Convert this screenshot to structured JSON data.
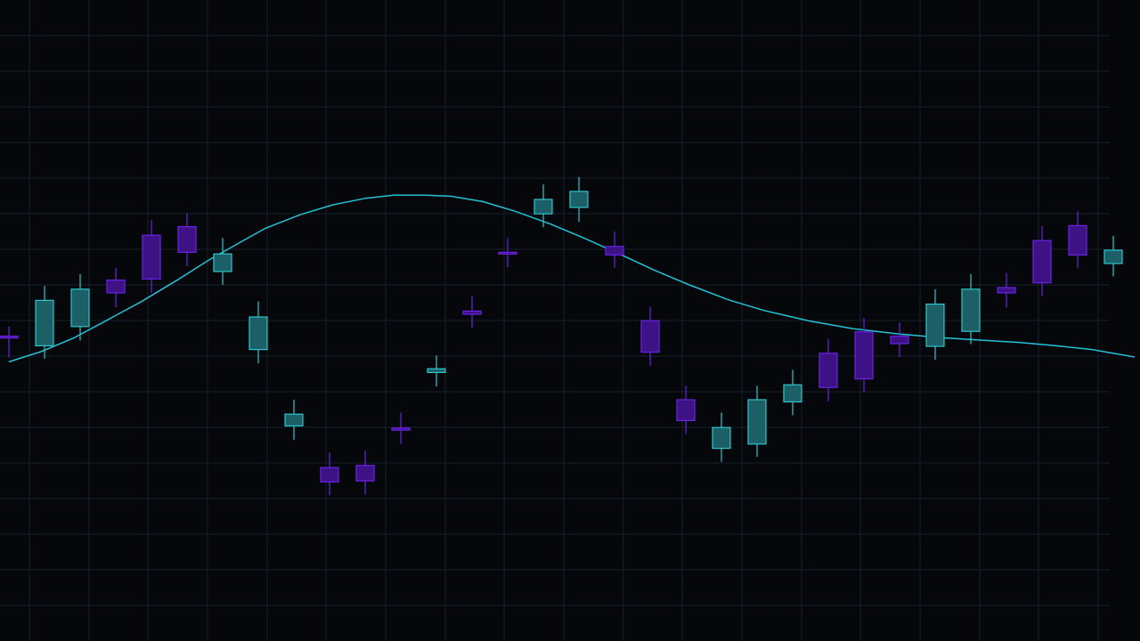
{
  "colors": {
    "background": "#05070b",
    "grid": "#16212c",
    "bullish": "#2ec5cc",
    "bullish_fill": "#1d5f66",
    "bearish": "#6c22e6",
    "bearish_fill": "#3c1284",
    "moving_average": "#22c3d6"
  },
  "chart_data": {
    "type": "candlestick",
    "title": "",
    "xlabel": "",
    "ylabel": "",
    "grid": true,
    "legend": "none",
    "x_ticks_labeled": false,
    "y_ticks_labeled": false,
    "xlim": [
      0,
      31.6
    ],
    "ylim": [
      0,
      100
    ],
    "candles": [
      {
        "x": 0,
        "open": 50.4,
        "close": 50.1,
        "high": 52.2,
        "low": 46.4
      },
      {
        "x": 1,
        "open": 48.6,
        "close": 57.1,
        "high": 59.8,
        "low": 46.2
      },
      {
        "x": 2,
        "open": 52.2,
        "close": 59.2,
        "high": 62.0,
        "low": 49.6
      },
      {
        "x": 3,
        "open": 60.9,
        "close": 58.5,
        "high": 63.2,
        "low": 55.8
      },
      {
        "x": 4,
        "open": 69.3,
        "close": 61.1,
        "high": 72.1,
        "low": 58.5
      },
      {
        "x": 5,
        "open": 70.9,
        "close": 66.1,
        "high": 73.5,
        "low": 63.5
      },
      {
        "x": 6,
        "open": 62.5,
        "close": 65.8,
        "high": 68.8,
        "low": 60.0
      },
      {
        "x": 7,
        "open": 47.9,
        "close": 54.0,
        "high": 56.9,
        "low": 45.3
      },
      {
        "x": 8,
        "open": 33.6,
        "close": 35.8,
        "high": 38.5,
        "low": 31.0
      },
      {
        "x": 9,
        "open": 25.8,
        "close": 23.1,
        "high": 28.6,
        "low": 20.6
      },
      {
        "x": 10,
        "open": 26.2,
        "close": 23.3,
        "high": 29.0,
        "low": 20.8
      },
      {
        "x": 11,
        "open": 33.2,
        "close": 32.8,
        "high": 36.1,
        "low": 30.2
      },
      {
        "x": 12,
        "open": 43.6,
        "close": 44.3,
        "high": 46.8,
        "low": 41.0
      },
      {
        "x": 13,
        "open": 55.1,
        "close": 54.5,
        "high": 57.9,
        "low": 52.0
      },
      {
        "x": 14,
        "open": 66.1,
        "close": 65.8,
        "high": 68.8,
        "low": 63.3
      },
      {
        "x": 15,
        "open": 73.3,
        "close": 76.0,
        "high": 78.8,
        "low": 70.8
      },
      {
        "x": 16,
        "open": 74.5,
        "close": 77.5,
        "high": 80.2,
        "low": 71.8
      },
      {
        "x": 17,
        "open": 67.2,
        "close": 65.6,
        "high": 70.0,
        "low": 63.2
      },
      {
        "x": 18,
        "open": 53.3,
        "close": 47.4,
        "high": 55.9,
        "low": 44.8
      },
      {
        "x": 19,
        "open": 38.5,
        "close": 34.6,
        "high": 41.1,
        "low": 32.1
      },
      {
        "x": 20,
        "open": 29.4,
        "close": 33.3,
        "high": 36.1,
        "low": 26.9
      },
      {
        "x": 21,
        "open": 30.2,
        "close": 38.5,
        "high": 41.1,
        "low": 27.8
      },
      {
        "x": 22,
        "open": 38.1,
        "close": 41.3,
        "high": 44.1,
        "low": 35.6
      },
      {
        "x": 23,
        "open": 47.2,
        "close": 40.8,
        "high": 49.9,
        "low": 38.2
      },
      {
        "x": 24,
        "open": 51.2,
        "close": 42.4,
        "high": 53.8,
        "low": 39.9
      },
      {
        "x": 25,
        "open": 50.4,
        "close": 49.0,
        "high": 53.0,
        "low": 46.5
      },
      {
        "x": 26,
        "open": 48.5,
        "close": 56.4,
        "high": 59.2,
        "low": 46.0
      },
      {
        "x": 27,
        "open": 51.3,
        "close": 59.2,
        "high": 62.0,
        "low": 48.9
      },
      {
        "x": 28,
        "open": 59.5,
        "close": 58.5,
        "high": 62.2,
        "low": 55.8
      },
      {
        "x": 29,
        "open": 68.3,
        "close": 60.4,
        "high": 71.0,
        "low": 57.9
      },
      {
        "x": 30,
        "open": 71.1,
        "close": 65.6,
        "high": 73.8,
        "low": 63.1
      },
      {
        "x": 31,
        "open": 64.0,
        "close": 66.5,
        "high": 69.2,
        "low": 61.6
      }
    ],
    "moving_average": {
      "x": [
        0,
        0.9,
        1.8,
        2.7,
        3.7,
        4.7,
        5.6,
        6.5,
        7.2,
        8.2,
        9.1,
        10.0,
        10.8,
        11.7,
        12.4,
        13.3,
        14.2,
        15.2,
        16.2,
        17.2,
        18.1,
        19.1,
        20.2,
        21.2,
        22.5,
        23.7,
        25.0,
        26.2,
        27.4,
        28.4,
        29.4,
        30.4,
        31.6
      ],
      "values": [
        45.6,
        47.5,
        50.0,
        53.2,
        56.8,
        60.8,
        64.6,
        68.0,
        70.6,
        73.2,
        75.0,
        76.2,
        76.8,
        76.8,
        76.6,
        75.6,
        73.8,
        71.4,
        68.6,
        65.6,
        62.8,
        60.0,
        57.2,
        55.2,
        53.2,
        51.8,
        50.8,
        50.1,
        49.6,
        49.2,
        48.6,
        47.9,
        46.5
      ]
    }
  }
}
